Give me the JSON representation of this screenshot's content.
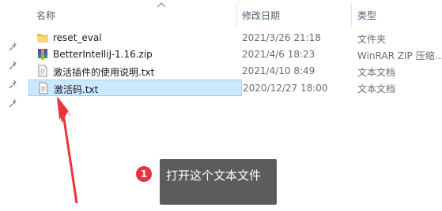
{
  "columns": {
    "name": "名称",
    "modified": "修改日期",
    "type": "类型"
  },
  "files": [
    {
      "name": "reset_eval",
      "modified": "2021/3/26 21:18",
      "type": "文件夹",
      "icon": "folder-icon"
    },
    {
      "name": "BetterIntelliJ-1.16.zip",
      "modified": "2021/4/6 18:23",
      "type": "WinRAR ZIP 压缩...",
      "icon": "winrar-archive-icon"
    },
    {
      "name": "激活插件的使用说明.txt",
      "modified": "2021/4/10 8:49",
      "type": "文本文档",
      "icon": "text-file-icon"
    },
    {
      "name": "激活码.txt",
      "modified": "2020/12/27 18:00",
      "type": "文本文档",
      "icon": "text-file-icon"
    }
  ],
  "callout": {
    "badge": "1",
    "text": "打开这个文本文件"
  },
  "colors": {
    "selection": "#cce8ff",
    "arrow": "#e8343c",
    "callout_bg": "#5c5c5c"
  }
}
